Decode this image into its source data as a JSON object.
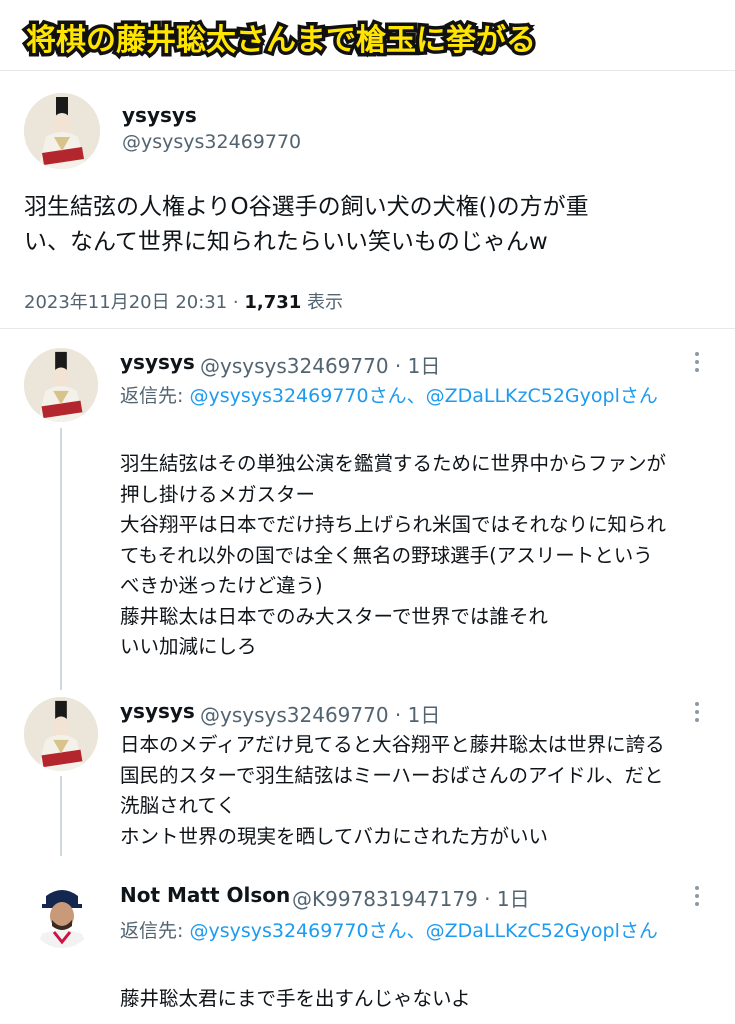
{
  "banner": {
    "text": "将棋の藤井聡太さんまで槍玉に挙がる"
  },
  "main_tweet": {
    "name": "ysysys",
    "handle": "@ysysys32469770",
    "text_line1": "羽生結弦の人権よりO谷選手の飼い犬の犬権()の方が重",
    "text_line2": "い、なんて世界に知られたらいい笑いものじゃんw",
    "timestamp": "2023年11月20日 20:31 · ",
    "views": "1,731",
    "views_label": " 表示"
  },
  "replies": [
    {
      "name": "ysysys",
      "handle": "@ysysys32469770 · 1日",
      "reply_prefix": "返信先: ",
      "reply_mentions": "@ysysys32469770さん、@ZDaLLKzC52Gyoplさん",
      "text": "羽生結弦はその単独公演を鑑賞するために世界中からファンが\n押し掛けるメガスター\n大谷翔平は日本でだけ持ち上げられ米国ではそれなりに知られ\nてもそれ以外の国では全く無名の野球選手(アスリートという\nべきか迷ったけど違う)\n藤井聡太は日本でのみ大スターで世界では誰それ\nいい加減にしろ"
    },
    {
      "name": "ysysys",
      "handle": "@ysysys32469770 · 1日",
      "text": "日本のメディアだけ見てると大谷翔平と藤井聡太は世界に誇る\n国民的スターで羽生結弦はミーハーおばさんのアイドル、だと\n洗脳されてく\nホント世界の現実を晒してバカにされた方がいい"
    },
    {
      "name": "Not Matt Olson",
      "handle": "@K997831947179 · 1日",
      "reply_prefix": "返信先: ",
      "reply_mentions": "@ysysys32469770さん、@ZDaLLKzC52Gyoplさん",
      "text": "藤井聡太君にまで手を出すんじゃないよ"
    }
  ],
  "colors": {
    "banner_fill": "#ffe500",
    "banner_stroke": "#111111",
    "mention": "#1d9bf0",
    "secondary": "#536471"
  }
}
